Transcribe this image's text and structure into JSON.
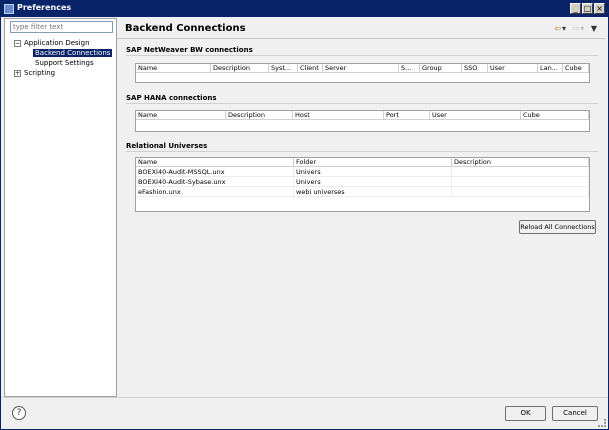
{
  "window": {
    "title": "Preferences",
    "min": "_",
    "max": "□",
    "close": "×"
  },
  "sidebar": {
    "filter_placeholder": "type filter text",
    "items": [
      {
        "label": "Application Design",
        "expander": "−"
      },
      {
        "label": "Backend Connections"
      },
      {
        "label": "Support Settings"
      },
      {
        "label": "Scripting",
        "expander": "+"
      }
    ]
  },
  "page": {
    "title": "Backend Connections",
    "nav": {
      "back": "⇦",
      "back_menu": "▾",
      "fwd": "⇨",
      "fwd_menu": "▾",
      "view_menu": "▼"
    }
  },
  "sections": {
    "bw": {
      "title": "SAP NetWeaver BW connections",
      "columns": [
        "Name",
        "Description",
        "Syst...",
        "Client",
        "Server",
        "S...",
        "Group",
        "SSO",
        "User",
        "Lan...",
        "Cube"
      ]
    },
    "hana": {
      "title": "SAP HANA connections",
      "columns": [
        "Name",
        "Description",
        "Host",
        "Port",
        "User",
        "Cube"
      ]
    },
    "relational": {
      "title": "Relational Universes",
      "columns": [
        "Name",
        "Folder",
        "Description"
      ],
      "rows": [
        [
          "BOEXI40-Audit-MSSQL.unx",
          "Univers",
          ""
        ],
        [
          "BOEXI40-Audit-Sybase.unx",
          "Univers",
          ""
        ],
        [
          "eFashion.unx",
          "webi universes",
          ""
        ]
      ]
    }
  },
  "reload_label": "Reload All Connections",
  "footer": {
    "help": "?",
    "ok": "OK",
    "cancel": "Cancel"
  }
}
